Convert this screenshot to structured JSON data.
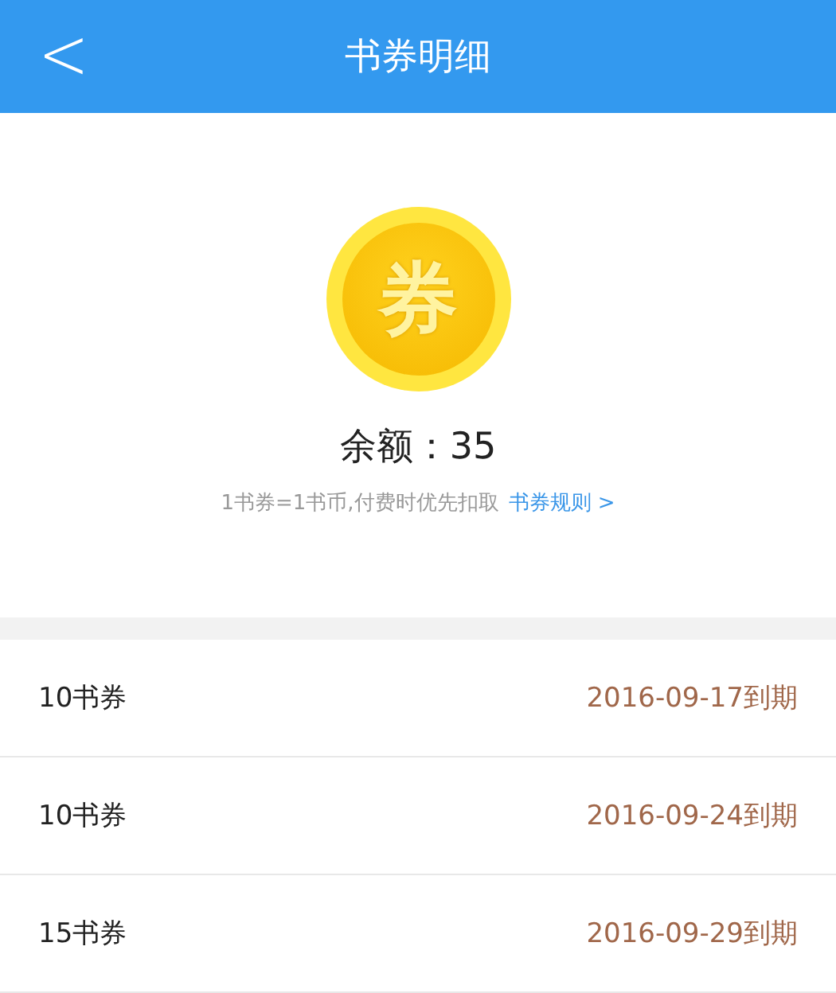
{
  "header": {
    "back": "<",
    "title": "书券明细"
  },
  "summary": {
    "coin": "券",
    "balance": "余额：35",
    "note": "1书券=1书币,付费时优先扣取",
    "rules_link": "书券规则 >"
  },
  "vouchers": [
    {
      "amount": "10书券",
      "expiry": "2016-09-17到期"
    },
    {
      "amount": "10书券",
      "expiry": "2016-09-24到期"
    },
    {
      "amount": "15书券",
      "expiry": "2016-09-29到期"
    }
  ]
}
